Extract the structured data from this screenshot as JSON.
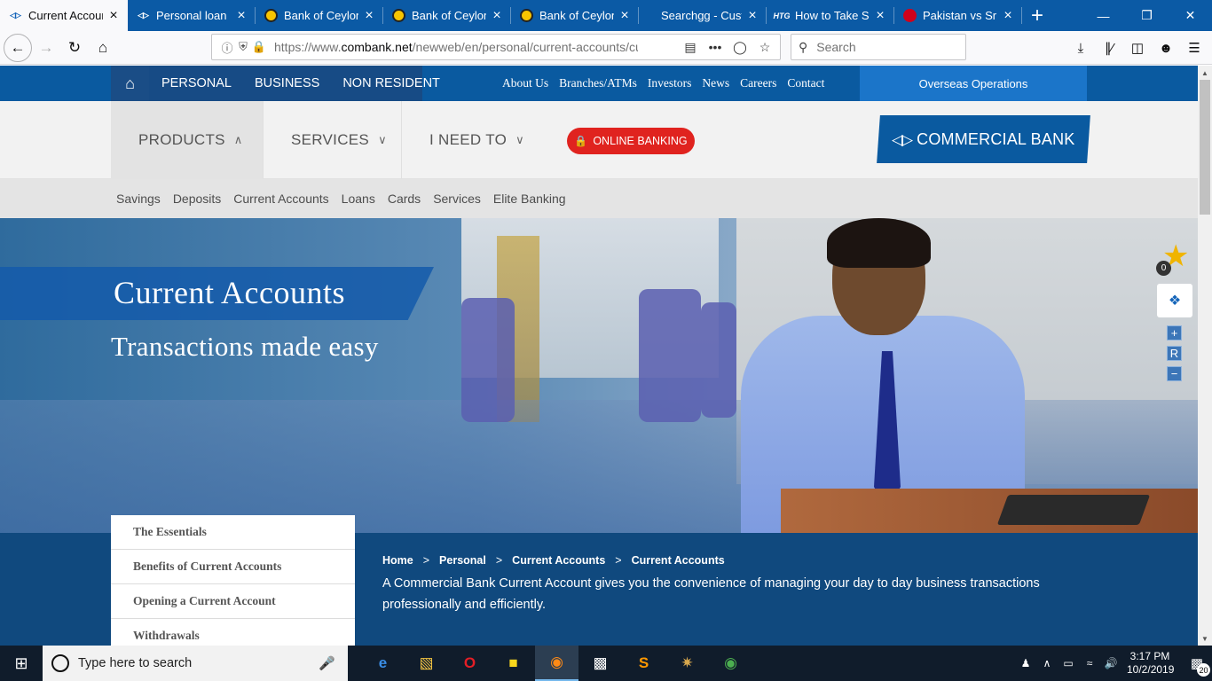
{
  "browser": {
    "tabs": [
      {
        "title": "Current Accoun",
        "favicon": "commercial-bank-icon",
        "active": true
      },
      {
        "title": "Personal loan | |",
        "favicon": "commercial-bank-icon",
        "active": false
      },
      {
        "title": "Bank of Ceylon",
        "favicon": "boc-icon",
        "active": false
      },
      {
        "title": "Bank of Ceylon",
        "favicon": "boc-icon",
        "active": false
      },
      {
        "title": "Bank of Ceylon",
        "favicon": "boc-icon",
        "active": false
      },
      {
        "title": "Searchgg - Custom",
        "favicon": "",
        "active": false
      },
      {
        "title": "How to Take Sc",
        "favicon": "htg-icon",
        "active": false
      },
      {
        "title": "Pakistan vs Sri L",
        "favicon": "news-icon",
        "active": false
      }
    ],
    "htg_label": "HTG",
    "url_prefix": "https://www.",
    "url_domain": "combank.net",
    "url_path": "/newweb/en/personal/current-accounts/cu",
    "search_placeholder": "Search",
    "accent_color": "#0b5aa5"
  },
  "site": {
    "segments": [
      "PERSONAL",
      "BUSINESS",
      "NON RESIDENT"
    ],
    "top_links": [
      "About Us",
      "Branches/ATMs",
      "Investors",
      "News",
      "Careers",
      "Contact"
    ],
    "overseas": "Overseas Operations",
    "main_nav": {
      "products": "PRODUCTS",
      "services": "SERVICES",
      "i_need_to": "I NEED TO"
    },
    "online_banking": "ONLINE BANKING",
    "logo_text": "COMMERCIAL BANK",
    "sub_nav": [
      "Savings",
      "Deposits",
      "Current Accounts",
      "Loans",
      "Cards",
      "Services",
      "Elite Banking"
    ],
    "hero": {
      "title": "Current Accounts",
      "subtitle": "Transactions made easy"
    },
    "favourites_count": "0",
    "zoom": {
      "plus": "+",
      "reset": "R",
      "minus": "−"
    },
    "side_menu": [
      "The Essentials",
      "Benefits of Current Accounts",
      "Opening a Current Account",
      "Withdrawals"
    ],
    "breadcrumb": [
      "Home",
      "Personal",
      "Current Accounts",
      "Current Accounts"
    ],
    "breadcrumb_sep": ">",
    "intro": "A Commercial Bank Current Account gives you the convenience of managing your day to day business transactions professionally and efficiently.",
    "brand_color": "#0a5aa0",
    "online_banking_color": "#e0231f"
  },
  "taskbar": {
    "search_placeholder": "Type here to search",
    "time": "3:17 PM",
    "date": "10/2/2019",
    "notification_count": "20"
  }
}
